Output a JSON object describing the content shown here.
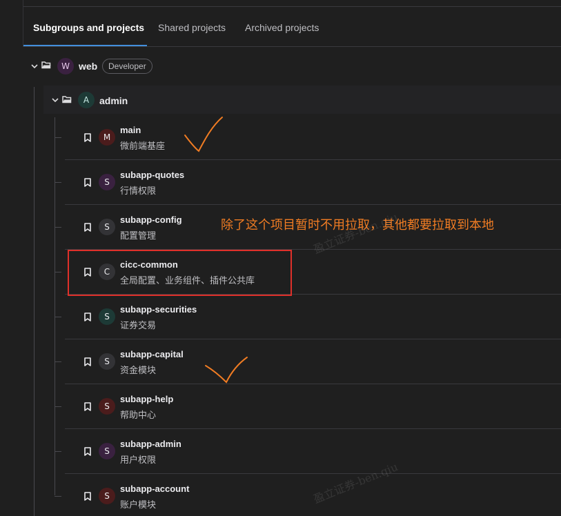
{
  "tabs": [
    {
      "label": "Subgroups and projects",
      "active": true
    },
    {
      "label": "Shared projects",
      "active": false
    },
    {
      "label": "Archived projects",
      "active": false
    }
  ],
  "group": {
    "name": "web",
    "avatar_letter": "W",
    "role_badge": "Developer",
    "icon": "folder-open-icon"
  },
  "subgroup": {
    "name": "admin",
    "avatar_letter": "A",
    "icon": "folder-open-icon"
  },
  "projects": [
    {
      "name": "main",
      "description": "微前端基座",
      "avatar_letter": "M",
      "avatar_color": "#4b1c1c",
      "icon": "bookmark-icon"
    },
    {
      "name": "subapp-quotes",
      "description": "行情权限",
      "avatar_letter": "S",
      "avatar_color": "#3a2140",
      "icon": "bookmark-icon"
    },
    {
      "name": "subapp-config",
      "description": "配置管理",
      "avatar_letter": "S",
      "avatar_color": "#333336",
      "icon": "bookmark-icon"
    },
    {
      "name": "cicc-common",
      "description": "全局配置、业务组件、插件公共库",
      "avatar_letter": "C",
      "avatar_color": "#333336",
      "icon": "bookmark-icon"
    },
    {
      "name": "subapp-securities",
      "description": "证券交易",
      "avatar_letter": "S",
      "avatar_color": "#1d3a36",
      "icon": "bookmark-icon"
    },
    {
      "name": "subapp-capital",
      "description": "资金模块",
      "avatar_letter": "S",
      "avatar_color": "#333336",
      "icon": "bookmark-icon"
    },
    {
      "name": "subapp-help",
      "description": "帮助中心",
      "avatar_letter": "S",
      "avatar_color": "#4b1c1c",
      "icon": "bookmark-icon"
    },
    {
      "name": "subapp-admin",
      "description": "用户权限",
      "avatar_letter": "S",
      "avatar_color": "#3a2140",
      "icon": "bookmark-icon"
    },
    {
      "name": "subapp-account",
      "description": "账户模块",
      "avatar_letter": "S",
      "avatar_color": "#4b1c1c",
      "icon": "bookmark-icon"
    }
  ],
  "annotation": {
    "text": "除了这个项目暂时不用拉取，其他都要拉取到本地",
    "color": "#f07c23",
    "box_color": "#e0302a"
  },
  "watermark": {
    "text": "盈立证券-ben.qiu"
  },
  "colors": {
    "background": "#1f1f1f",
    "tab_underline": "#428fdc"
  }
}
